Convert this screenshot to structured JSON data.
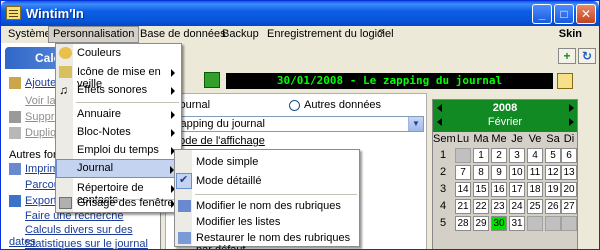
{
  "window": {
    "title": "Wintim'In"
  },
  "menubar": {
    "items": [
      {
        "label": "Système"
      },
      {
        "label": "Personnalisation"
      },
      {
        "label": "Base de données"
      },
      {
        "label": "Backup"
      },
      {
        "label": "Enregistrement du logiciel"
      },
      {
        "label": "?"
      }
    ],
    "skin": "Skin"
  },
  "leftpanel": {
    "header": "Cale",
    "rows": [
      {
        "label": "Ajouter s"
      },
      {
        "label": "Voir la p"
      },
      {
        "label": "Supprim"
      },
      {
        "label": "Dupliqu"
      },
      {
        "label": "Autres fonct"
      },
      {
        "label": "Imprim"
      },
      {
        "label": "Parcour"
      },
      {
        "label": "Exporter"
      },
      {
        "label": "Faire une recherche"
      },
      {
        "label": "Calculs divers sur des dates"
      },
      {
        "label": "Statistiques sur le journal"
      }
    ]
  },
  "main": {
    "banner": "30/01/2008 - Le zapping du journal",
    "radio_journal": "Journal",
    "radio_autres": "Autres données",
    "combo_value": "zapping du journal",
    "mode_label": "dode de l'affichage"
  },
  "calendar": {
    "year": "2008",
    "month": "Février",
    "days": [
      "Sem",
      "Lu",
      "Ma",
      "Me",
      "Je",
      "Ve",
      "Sa",
      "Di"
    ],
    "weeks": [
      {
        "week": "1",
        "cells": [
          "1",
          "2",
          "3",
          "4",
          "5",
          "6"
        ]
      },
      {
        "week": "2",
        "cells": [
          "7",
          "8",
          "9",
          "10",
          "11",
          "12",
          "13"
        ]
      },
      {
        "week": "3",
        "cells": [
          "14",
          "15",
          "16",
          "17",
          "18",
          "19",
          "20"
        ]
      },
      {
        "week": "4",
        "cells": [
          "21",
          "22",
          "23",
          "24",
          "25",
          "26",
          "27"
        ]
      },
      {
        "week": "5",
        "cells": [
          "28",
          "29",
          "30",
          "31"
        ]
      }
    ],
    "today": "30"
  },
  "dropdown": {
    "items": [
      {
        "label": "Couleurs",
        "arrow": false
      },
      {
        "label": "Icône de mise en veille",
        "arrow": true
      },
      {
        "label": "Effets sonores",
        "arrow": true
      },
      {
        "label": "Annuaire",
        "arrow": true
      },
      {
        "label": "Bloc-Notes",
        "arrow": true
      },
      {
        "label": "Emploi du temps",
        "arrow": true
      },
      {
        "label": "Journal",
        "arrow": true
      },
      {
        "label": "Répertoire de contacts",
        "arrow": true
      },
      {
        "label": "Grisage des fenêtres",
        "arrow": true
      }
    ]
  },
  "submenu": {
    "items": [
      {
        "label": "Mode simple"
      },
      {
        "label": "Mode détaillé"
      },
      {
        "label": "Modifier le nom des rubriques"
      },
      {
        "label": "Modifier les listes"
      },
      {
        "label": "Restaurer le nom des rubriques par défaut"
      }
    ]
  },
  "colors": {
    "title_bar": "#0654d8",
    "banner_bg": "#000000",
    "banner_text": "#00ff00",
    "calendar_header": "#118a23",
    "today_cell": "#00e000",
    "menu_highlight": "#c4d3ef"
  }
}
